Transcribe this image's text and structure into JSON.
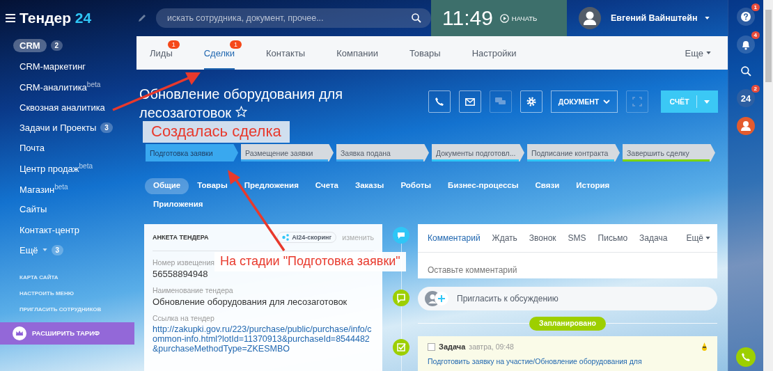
{
  "header": {
    "logo": {
      "name": "Тендер",
      "accent": "24"
    },
    "search": {
      "placeholder": "искать сотрудника, документ, прочее..."
    },
    "clock": "11:49",
    "start": "НАЧАТЬ",
    "user": "Евгений Вайнштейн"
  },
  "sidebar": {
    "crm": {
      "label": "CRM",
      "count": "2"
    },
    "items": [
      {
        "label": "CRM-маркетинг"
      },
      {
        "label": "CRM-аналитика",
        "sup": "beta"
      },
      {
        "label": "Сквозная аналитика"
      },
      {
        "label": "Задачи и Проекты",
        "count": "3"
      },
      {
        "label": "Почта"
      },
      {
        "label": "Центр продаж",
        "sup": "beta"
      },
      {
        "label": "Магазин",
        "sup": "beta"
      },
      {
        "label": "Сайты"
      },
      {
        "label": "Контакт-центр"
      }
    ],
    "more": {
      "label": "Ещё",
      "count": "3"
    },
    "links": [
      "КАРТА САЙТА",
      "НАСТРОИТЬ МЕНЮ",
      "ПРИГЛАСИТЬ СОТРУДНИКОВ"
    ],
    "upgrade": "РАСШИРИТЬ ТАРИФ"
  },
  "tabs": [
    {
      "label": "Лиды",
      "badge": "1",
      "selected": false
    },
    {
      "label": "Сделки",
      "badge": "1",
      "selected": true
    },
    {
      "label": "Контакты",
      "selected": false
    },
    {
      "label": "Компании",
      "selected": false
    },
    {
      "label": "Товары",
      "selected": false
    },
    {
      "label": "Настройки",
      "selected": false
    }
  ],
  "tabs_more": "Еще",
  "deal": {
    "title": "Обновление оборудования для лесозаготовок",
    "document": "ДОКУМЕНТ",
    "invoice": "СЧЁТ"
  },
  "stages": [
    {
      "label": "Подготовка заявки",
      "selected": true,
      "color": "#39a8ef"
    },
    {
      "label": "Размещение заявки",
      "selected": false,
      "color": "#39a8ef"
    },
    {
      "label": "Заявка подана",
      "selected": false,
      "color": "#39a8ef"
    },
    {
      "label": "Документы подготовл...",
      "selected": false,
      "color": "#2fc6f6"
    },
    {
      "label": "Подписание контракта",
      "selected": false,
      "color": "#2fc6f6"
    },
    {
      "label": "Завершить сделку",
      "selected": false,
      "color": "#7bd500"
    }
  ],
  "detail_tabs": [
    {
      "label": "Общие",
      "selected": true
    },
    {
      "label": "Товары",
      "selected": false
    },
    {
      "label": "Предложения",
      "selected": false
    },
    {
      "label": "Счета",
      "selected": false
    },
    {
      "label": "Заказы",
      "selected": false
    },
    {
      "label": "Роботы",
      "selected": false
    },
    {
      "label": "Бизнес-процессы",
      "selected": false
    },
    {
      "label": "Связи",
      "selected": false
    },
    {
      "label": "История",
      "selected": false
    },
    {
      "label": "Приложения",
      "selected": false
    }
  ],
  "form": {
    "title": "АНКЕТА ТЕНДЕРА",
    "scoring": "AI24-скоринг",
    "edit": "изменить",
    "fields": [
      {
        "label": "Номер извещения",
        "value": "56558894948",
        "kind": "text"
      },
      {
        "label": "Наименование тендера",
        "value": "Обновление оборудования для лесозаготовок",
        "kind": "text"
      },
      {
        "label": "Ссылка на тендер",
        "value": "http://zakupki.gov.ru/223/purchase/public/purchase/info/common-info.html?lotId=11370913&purchaseId=8544482&purchaseMethodType=ZKESMBO",
        "kind": "link"
      }
    ]
  },
  "timeline": {
    "tabs": [
      {
        "label": "Комментарий",
        "selected": true
      },
      {
        "label": "Ждать",
        "selected": false
      },
      {
        "label": "Звонок",
        "selected": false
      },
      {
        "label": "SMS",
        "selected": false
      },
      {
        "label": "Письмо",
        "selected": false
      },
      {
        "label": "Задача",
        "selected": false
      }
    ],
    "more": "Ещё",
    "comment_placeholder": "Оставьте комментарий",
    "invite": "Пригласить к обсуждению",
    "planned": "Запланировано",
    "task": {
      "type": "Задача",
      "time": "завтра, 09:48",
      "checked": false,
      "title": "Подготовить заявку на участие/Обновление оборудования для"
    }
  },
  "rail": {
    "help_badge": "1",
    "bell_badge": "4",
    "b24": "24",
    "b24_badge": "2"
  },
  "annotations": [
    {
      "text": "Создалась сделка"
    },
    {
      "text": "На стадии \"Подготовка заявки\""
    }
  ]
}
